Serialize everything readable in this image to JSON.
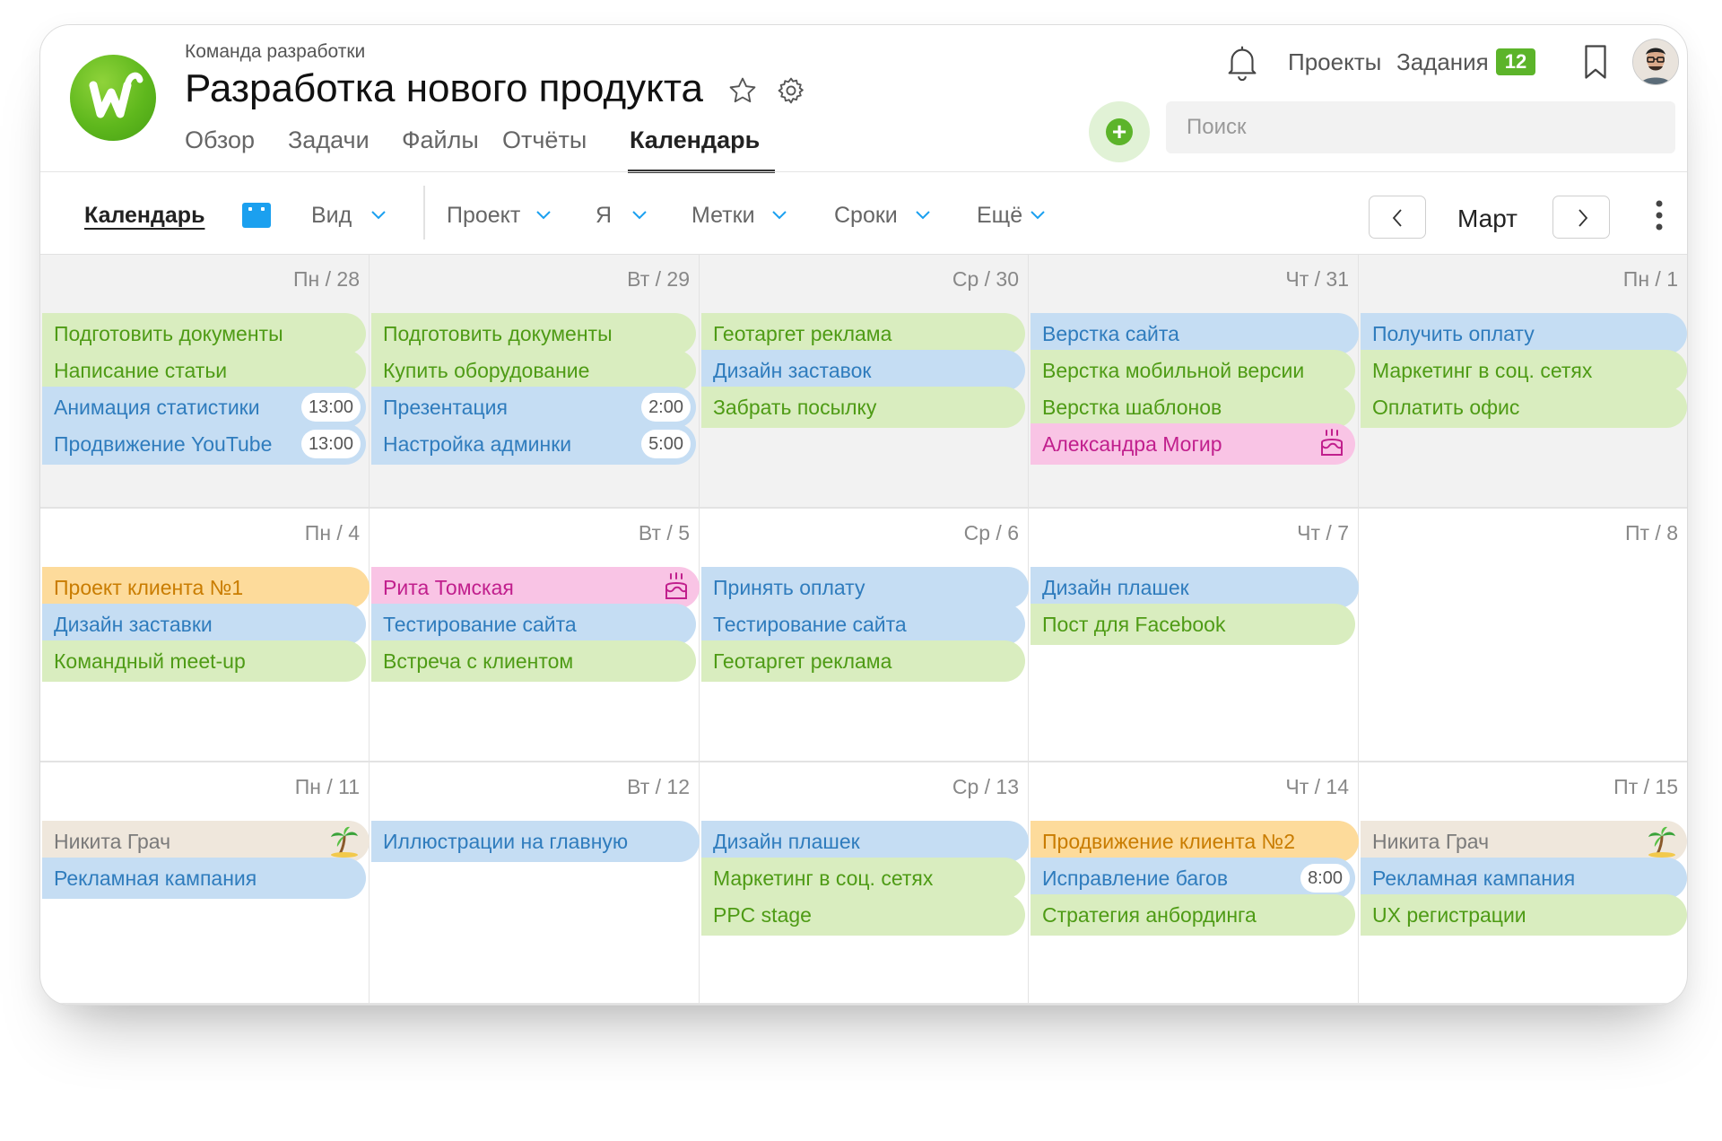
{
  "header": {
    "team": "Команда разработки",
    "title": "Разработка нового продукта",
    "tabs": [
      {
        "label": "Обзор"
      },
      {
        "label": "Задачи"
      },
      {
        "label": "Файлы"
      },
      {
        "label": "Отчёты"
      },
      {
        "label": "Календарь",
        "active": true
      }
    ],
    "nav": {
      "projects": "Проекты",
      "tasks": "Задания",
      "tasks_count": "12"
    },
    "search": {
      "placeholder": "Поиск"
    }
  },
  "toolbar": {
    "calendar_label": "Календарь",
    "filters": {
      "view": "Вид",
      "project": "Проект",
      "me": "Я",
      "tags": "Метки",
      "dates": "Сроки",
      "more": "Ещё"
    },
    "month": "Март"
  },
  "colors": {
    "accent_green": "#5cb42a",
    "calendar_icon": "#1ba0ef",
    "event_green": "#d9edbf",
    "event_blue": "#c5ddf3",
    "event_pink": "#f9c4e5",
    "event_orange": "#fddb9b",
    "event_beige": "#efe7dc"
  },
  "weeks": [
    {
      "days": [
        {
          "label": "Пн / 28",
          "events": [
            {
              "title": "Подготовить документы",
              "color": "green"
            },
            {
              "title": "Написание статьи",
              "color": "green"
            },
            {
              "title": "Анимация статистики",
              "color": "blue",
              "time": "13:00"
            },
            {
              "title": "Продвижение YouTube",
              "color": "blue",
              "time": "13:00"
            }
          ]
        },
        {
          "label": "Вт / 29",
          "events": [
            {
              "title": "Подготовить документы",
              "color": "green"
            },
            {
              "title": "Купить оборудование",
              "color": "green"
            },
            {
              "title": "Презентация",
              "color": "blue",
              "time": "2:00"
            },
            {
              "title": "Настройка админки",
              "color": "blue",
              "time": "5:00"
            }
          ]
        },
        {
          "label": "Ср / 30",
          "events": [
            {
              "title": "Геотаргет реклама",
              "color": "green"
            },
            {
              "title": "Дизайн заставок",
              "color": "blue"
            },
            {
              "title": "Забрать посылку",
              "color": "green"
            }
          ]
        },
        {
          "label": "Чт / 31",
          "events": [
            {
              "title": "Верстка сайта",
              "color": "blue"
            },
            {
              "title": "Верстка мобильной версии",
              "color": "green"
            },
            {
              "title": "Верстка шаблонов",
              "color": "green"
            },
            {
              "title": "Александра Могир",
              "color": "pink",
              "icon": "birthday-cake-icon"
            }
          ]
        },
        {
          "label": "Пн / 1",
          "events": [
            {
              "title": "Получить оплату",
              "color": "blue"
            },
            {
              "title": "Маркетинг в соц. сетях",
              "color": "green"
            },
            {
              "title": "Оплатить офис",
              "color": "green"
            }
          ]
        }
      ]
    },
    {
      "days": [
        {
          "label": "Пн / 4",
          "events": [
            {
              "title": "Проект клиента №1",
              "color": "orange"
            },
            {
              "title": "Дизайн заставки",
              "color": "blue"
            },
            {
              "title": "Командный meet-up",
              "color": "green"
            }
          ]
        },
        {
          "label": "Вт / 5",
          "events": [
            {
              "title": "Рита Томская",
              "color": "pink",
              "icon": "birthday-cake-icon"
            },
            {
              "title": "Тестирование сайта",
              "color": "blue"
            },
            {
              "title": "Встреча с клиентом",
              "color": "green"
            }
          ]
        },
        {
          "label": "Ср / 6",
          "events": [
            {
              "title": "Принять оплату",
              "color": "blue"
            },
            {
              "title": "Тестирование сайта",
              "color": "blue"
            },
            {
              "title": "Геотаргет реклама",
              "color": "green"
            }
          ]
        },
        {
          "label": "Чт / 7",
          "events": [
            {
              "title": "Дизайн плашек",
              "color": "blue"
            },
            {
              "title": "Пост для Facebook",
              "color": "green"
            }
          ]
        },
        {
          "label": "Пт / 8",
          "events": []
        }
      ]
    },
    {
      "days": [
        {
          "label": "Пн / 11",
          "events": [
            {
              "title": "Никита Грач",
              "color": "beige",
              "icon": "palm-tree-icon"
            },
            {
              "title": "Рекламная кампания",
              "color": "blue"
            }
          ]
        },
        {
          "label": "Вт / 12",
          "events": [
            {
              "title": "Иллюстрации на главную",
              "color": "blue"
            }
          ]
        },
        {
          "label": "Ср / 13",
          "events": [
            {
              "title": "Дизайн плашек",
              "color": "blue"
            },
            {
              "title": "Маркетинг в соц. сетях",
              "color": "green"
            },
            {
              "title": "PPC stage",
              "color": "green"
            }
          ]
        },
        {
          "label": "Чт / 14",
          "events": [
            {
              "title": "Продвижение клиента №2",
              "color": "orange"
            },
            {
              "title": "Исправление багов",
              "color": "blue",
              "time": "8:00"
            },
            {
              "title": "Стратегия анбординга",
              "color": "green"
            }
          ]
        },
        {
          "label": "Пт / 15",
          "events": [
            {
              "title": "Никита Грач",
              "color": "beige",
              "icon": "palm-tree-icon"
            },
            {
              "title": "Рекламная кампания",
              "color": "blue"
            },
            {
              "title": "UX регистрации",
              "color": "green"
            }
          ]
        }
      ]
    }
  ]
}
